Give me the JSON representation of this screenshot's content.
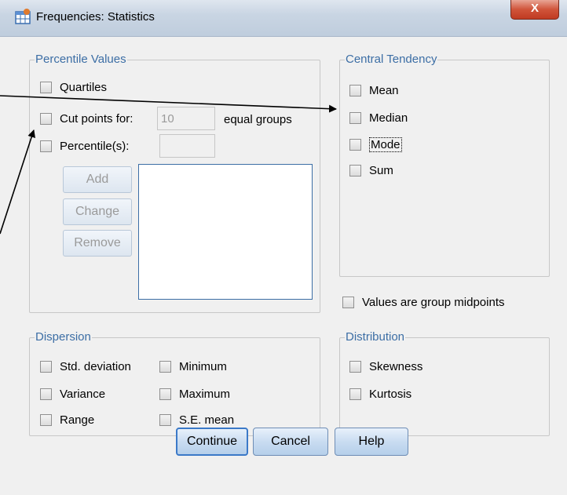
{
  "window": {
    "title": "Frequencies: Statistics",
    "close_label": "X"
  },
  "percentile_values": {
    "legend": "Percentile Values",
    "quartiles": {
      "label": "Quartiles",
      "checked": false
    },
    "cut_points": {
      "label": "Cut points for:",
      "value": "10",
      "suffix": "equal groups",
      "checked": false
    },
    "percentiles": {
      "label": "Percentile(s):",
      "value": "",
      "checked": false
    },
    "buttons": {
      "add": "Add",
      "change": "Change",
      "remove": "Remove"
    }
  },
  "central_tendency": {
    "legend": "Central Tendency",
    "items": [
      {
        "label": "Mean",
        "checked": false
      },
      {
        "label": "Median",
        "checked": false
      },
      {
        "label": "Mode",
        "checked": false
      },
      {
        "label": "Sum",
        "checked": false
      }
    ]
  },
  "values_group_midpoints": {
    "label": "Values are group midpoints",
    "checked": false
  },
  "dispersion": {
    "legend": "Dispersion",
    "items": [
      {
        "label": "Std. deviation",
        "checked": false
      },
      {
        "label": "Minimum",
        "checked": false
      },
      {
        "label": "Variance",
        "checked": false
      },
      {
        "label": "Maximum",
        "checked": false
      },
      {
        "label": "Range",
        "checked": false
      },
      {
        "label": "S.E. mean",
        "checked": false
      }
    ]
  },
  "distribution": {
    "legend": "Distribution",
    "items": [
      {
        "label": "Skewness",
        "checked": false
      },
      {
        "label": "Kurtosis",
        "checked": false
      }
    ]
  },
  "dialog_buttons": {
    "continue": "Continue",
    "cancel": "Cancel",
    "help": "Help"
  },
  "colors": {
    "legend": "#3c6ea5",
    "titlebar": "#c9d5e3",
    "close": "#c03b22",
    "arrow": "#000000"
  },
  "icons": {
    "app": "spss-table-icon",
    "close": "close-icon",
    "checkbox": "checkbox-icon"
  }
}
